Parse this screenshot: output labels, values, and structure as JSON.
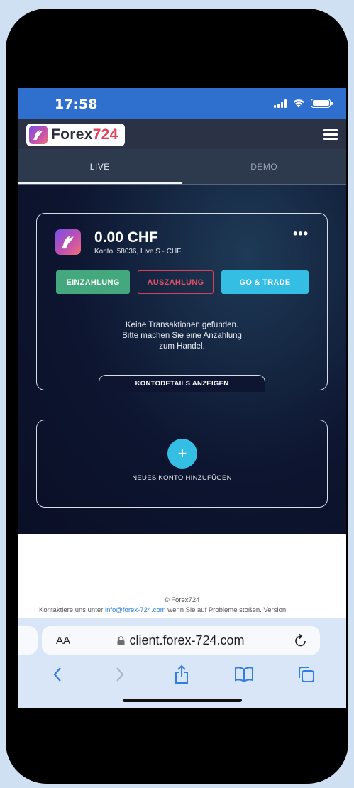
{
  "status_bar": {
    "time": "17:58"
  },
  "header": {
    "logo_text": "Forex",
    "logo_number": "724"
  },
  "tabs": [
    {
      "label": "LIVE",
      "active": true
    },
    {
      "label": "DEMO",
      "active": false
    }
  ],
  "account_card": {
    "balance": "0.00 CHF",
    "account_info": "Konto:  58036, Live S - CHF",
    "more_label": "•••",
    "deposit_label": "EINZAHLUNG",
    "withdraw_label": "AUSZAHLUNG",
    "trade_label": "GO & TRADE",
    "empty_line1": "Keine Transaktionen gefunden.",
    "empty_line2": "Bitte machen Sie eine Anzahlung",
    "empty_line3": "zum Handel.",
    "details_label": "KONTODETAILS ANZEIGEN"
  },
  "add_account": {
    "plus": "+",
    "label": "NEUES KONTO HINZUFÜGEN"
  },
  "footer": {
    "copyright": "© Forex724",
    "contact_prefix": "Kontaktiere uns unter ",
    "contact_link": "info@forex-724.com",
    "contact_suffix": " wenn Sie auf Probleme stoßen. Version:"
  },
  "browser": {
    "aa_label": "AA",
    "url": "client.forex-724.com"
  },
  "colors": {
    "status_bar": "#2f6fce",
    "deposit": "#44a87e",
    "withdraw": "#d9415a",
    "trade": "#35bee4"
  }
}
